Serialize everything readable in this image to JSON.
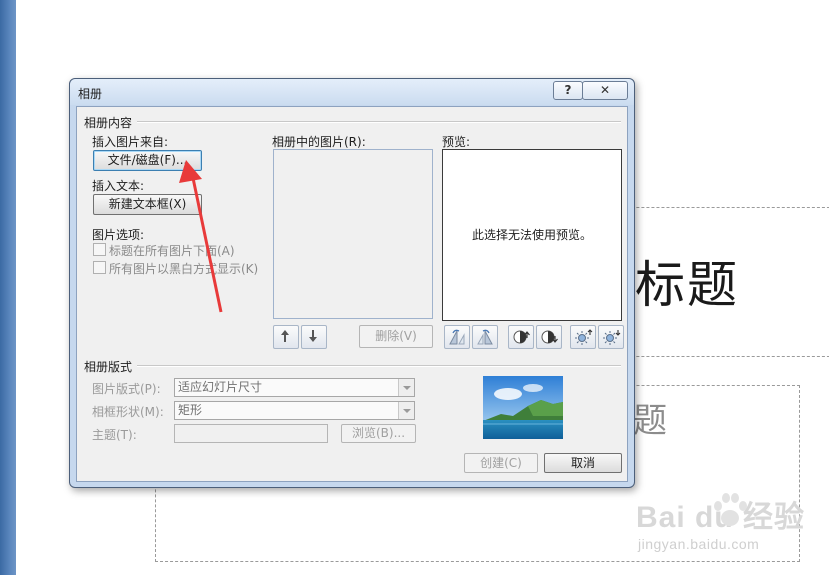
{
  "slide": {
    "title_fragment": "标题",
    "subtitle_fragment": "题"
  },
  "watermark": {
    "logo": "Bai du 经验",
    "url": "jingyan.baidu.com"
  },
  "dialog": {
    "title": "相册",
    "help_label": "?",
    "close_label": "✕",
    "album_content": {
      "group_label": "相册内容",
      "insert_from_label": "插入图片来自:",
      "file_disk_button": "文件/磁盘(F)...",
      "insert_text_label": "插入文本:",
      "new_textbox_button": "新建文本框(X)",
      "picture_options_label": "图片选项:",
      "caption_checkbox": "标题在所有图片下面(A)",
      "bw_checkbox": "所有图片以黑白方式显示(K)",
      "pictures_in_album_label": "相册中的图片(R):",
      "preview_label": "预览:",
      "preview_message": "此选择无法使用预览。",
      "remove_button": "删除(V)"
    },
    "album_layout": {
      "group_label": "相册版式",
      "picture_layout_label": "图片版式(P):",
      "picture_layout_value": "适应幻灯片尺寸",
      "frame_shape_label": "相框形状(M):",
      "frame_shape_value": "矩形",
      "theme_label": "主题(T):",
      "theme_value": "",
      "browse_button": "浏览(B)..."
    },
    "create_button": "创建(C)",
    "cancel_button": "取消"
  },
  "colors": {
    "dialog_frame": "#c6d8ee",
    "client_bg": "#f0f0f0",
    "annotation_arrow": "#e83a3a"
  }
}
